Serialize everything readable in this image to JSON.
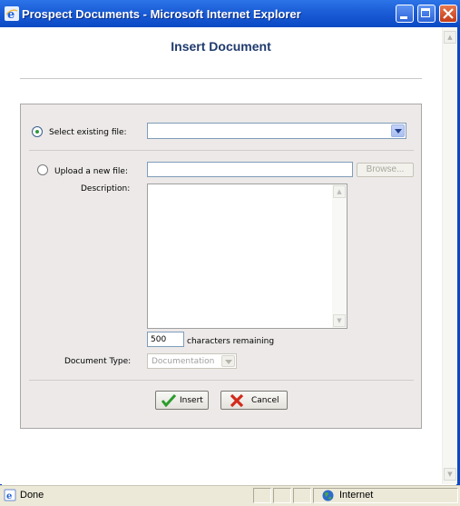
{
  "window": {
    "title": "Prospect Documents - Microsoft Internet Explorer",
    "icon": "ie-icon",
    "controls": [
      "minimize",
      "maximize",
      "close"
    ]
  },
  "page": {
    "title": "Insert Document"
  },
  "form": {
    "existing_label": "Select existing file:",
    "existing_selected": true,
    "existing_value": "",
    "upload_label": "Upload a new file:",
    "upload_selected": false,
    "upload_value": "",
    "browse_label": "Browse...",
    "description_label": "Description:",
    "description_value": "",
    "chars_count": "500",
    "chars_label": "characters remaining",
    "doctype_label": "Document Type:",
    "doctype_value": "Documentation",
    "insert_label": "Insert",
    "cancel_label": "Cancel"
  },
  "status": {
    "left": "Done",
    "zone": "Internet"
  },
  "colors": {
    "titlebar": "#0b49c4",
    "title_text": "#1f3a6e",
    "panel_bg": "#ece9e8",
    "radio_dot": "#2f9a3a"
  }
}
